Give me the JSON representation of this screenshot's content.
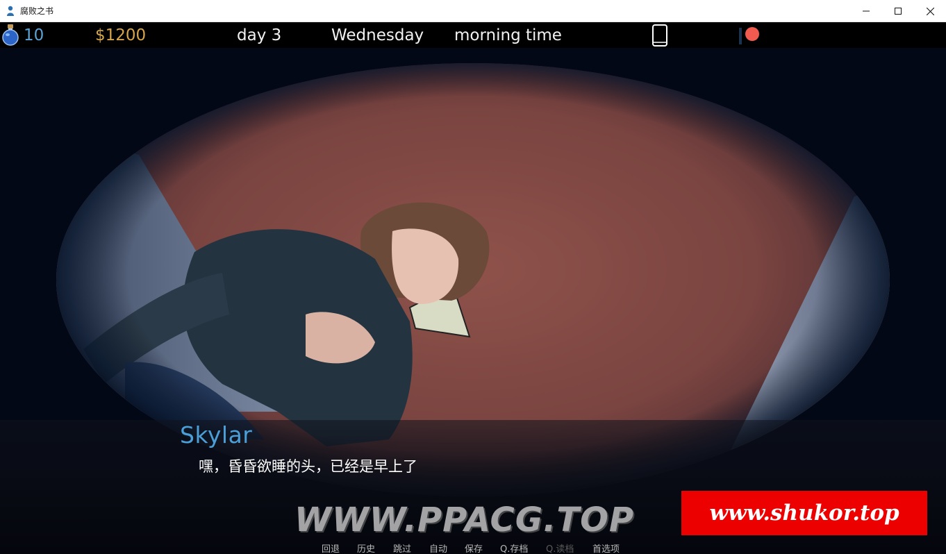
{
  "window": {
    "title": "腐败之书",
    "icon": "app-person-icon",
    "controls": [
      "minimize-icon",
      "maximize-icon",
      "close-icon"
    ]
  },
  "hud": {
    "energy": "10",
    "money": "$1200",
    "day": "day 3",
    "weekday": "Wednesday",
    "time_of_day": "morning time",
    "icons": [
      "potion-icon",
      "phone-icon",
      "notification-dot-icon"
    ]
  },
  "dialogue": {
    "speaker": "Skylar",
    "text": "嘿，昏昏欲睡的头，已经是早上了"
  },
  "quick_menu": [
    {
      "label": "回退",
      "enabled": true
    },
    {
      "label": "历史",
      "enabled": true
    },
    {
      "label": "跳过",
      "enabled": true
    },
    {
      "label": "自动",
      "enabled": true
    },
    {
      "label": "保存",
      "enabled": true
    },
    {
      "label": "Q.存档",
      "enabled": true
    },
    {
      "label": "Q.读档",
      "enabled": false
    },
    {
      "label": "首选项",
      "enabled": true
    }
  ],
  "watermarks": {
    "ppacg": "WWW.PPACG.TOP",
    "shukor": "www.shukor.top"
  },
  "colors": {
    "energy": "#5aa3d6",
    "money": "#d6a54a",
    "speaker": "#4c9fd6",
    "notification": "#f05a4f",
    "watermark_bg": "#ec0000"
  }
}
